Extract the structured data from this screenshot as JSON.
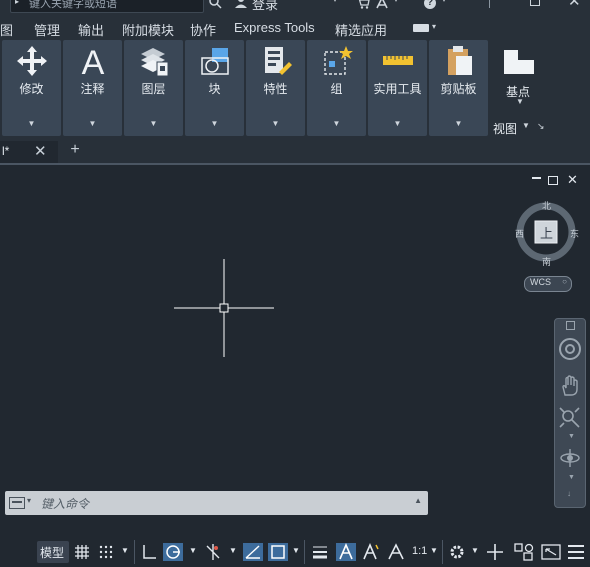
{
  "titlebar": {
    "search_placeholder": "键入关键字或短语",
    "login_label": "登录"
  },
  "menu": {
    "items": [
      "图",
      "管理",
      "输出",
      "附加模块",
      "协作",
      "Express Tools",
      "精选应用"
    ]
  },
  "ribbon": {
    "panels": [
      {
        "label": "修改",
        "icon": "move-arrows-icon"
      },
      {
        "label": "注释",
        "icon": "text-A-icon"
      },
      {
        "label": "图层",
        "icon": "layers-icon"
      },
      {
        "label": "块",
        "icon": "block-icon"
      },
      {
        "label": "特性",
        "icon": "properties-icon"
      },
      {
        "label": "组",
        "icon": "group-icon"
      },
      {
        "label": "实用工具",
        "icon": "ruler-icon"
      },
      {
        "label": "剪贴板",
        "icon": "clipboard-icon"
      },
      {
        "label": "基点",
        "icon": "base-point-icon"
      }
    ],
    "view_label": "视图"
  },
  "document_tab": {
    "label": "l*"
  },
  "viewcube": {
    "north": "北",
    "south": "南",
    "east": "东",
    "west": "西",
    "face": "上",
    "wcs": "WCS"
  },
  "command_line": {
    "placeholder": "键入命令"
  },
  "statusbar": {
    "model_label": "模型",
    "scale_label": "1:1"
  },
  "colors": {
    "background": "#212830",
    "panel": "#3a4756",
    "active_toggle": "#3d6c9c"
  }
}
